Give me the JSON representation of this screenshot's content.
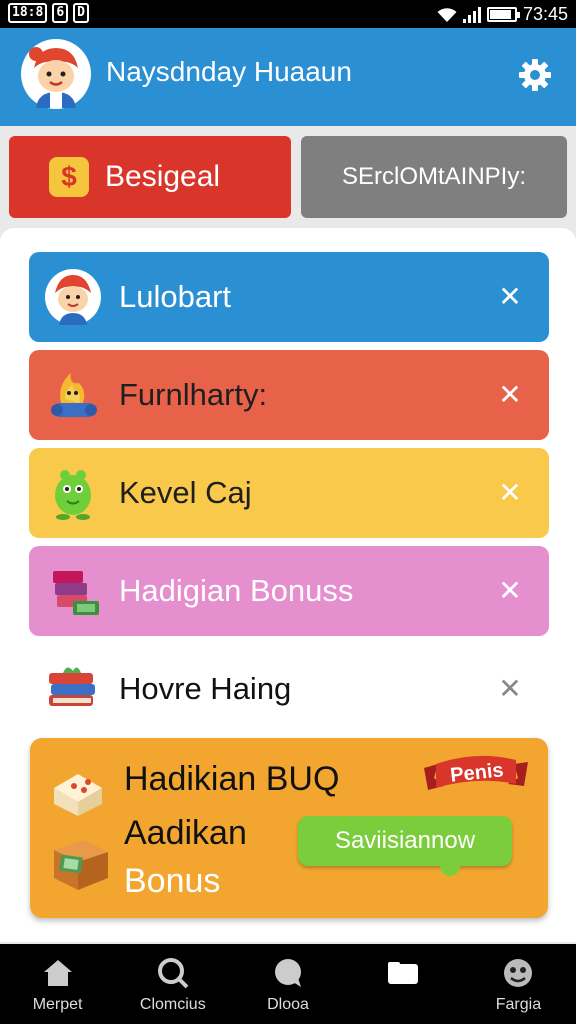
{
  "status_bar": {
    "left_chips": [
      "18:8",
      "6",
      "D"
    ],
    "time": "73:45",
    "icons": [
      "wifi-icon",
      "signal-icon",
      "battery-icon"
    ]
  },
  "header": {
    "title": "Naysdnday Huaaun",
    "avatar_icon": "mascot-avatar-icon",
    "settings_icon": "gear-icon",
    "bg_color": "#2b8fd3"
  },
  "top_buttons": {
    "primary_label": "Besigeal",
    "primary_icon": "dollar-icon",
    "primary_color": "#d9352a",
    "secondary_label": "SErclOMtAINPIy:",
    "secondary_color": "#7f7f80"
  },
  "items": [
    {
      "label": "Lulobart",
      "icon": "mascot-icon",
      "color": "#2b8fd3",
      "close_icon": "close-icon"
    },
    {
      "label": "Furnlharty:",
      "icon": "fire-creature-icon",
      "color": "#e8624a",
      "close_icon": "close-icon"
    },
    {
      "label": "Kevel Caj",
      "icon": "green-creature-icon",
      "color": "#f8c94a",
      "close_icon": "close-icon"
    },
    {
      "label": "Hadigian Bonuss",
      "icon": "books-icon",
      "color": "#e68fcf",
      "close_icon": "close-icon"
    },
    {
      "label": "Hovre Haing",
      "icon": "book-stack-icon",
      "color": "#ffffff",
      "close_icon": "close-icon"
    }
  ],
  "bonus_card": {
    "line1": "Hadikian BUQ",
    "line2": "Aadikan",
    "line3": "Bonus",
    "ribbon": "Penis",
    "save_button": "Saviisiannow",
    "color": "#f2a630"
  },
  "bottom_nav": [
    {
      "label": "Merpet",
      "icon": "home-icon"
    },
    {
      "label": "Clomcius",
      "icon": "search-icon"
    },
    {
      "label": "Dlooa",
      "icon": "chat-icon"
    },
    {
      "label": "",
      "icon": "folder-icon"
    },
    {
      "label": "Fargia",
      "icon": "profile-icon"
    }
  ]
}
